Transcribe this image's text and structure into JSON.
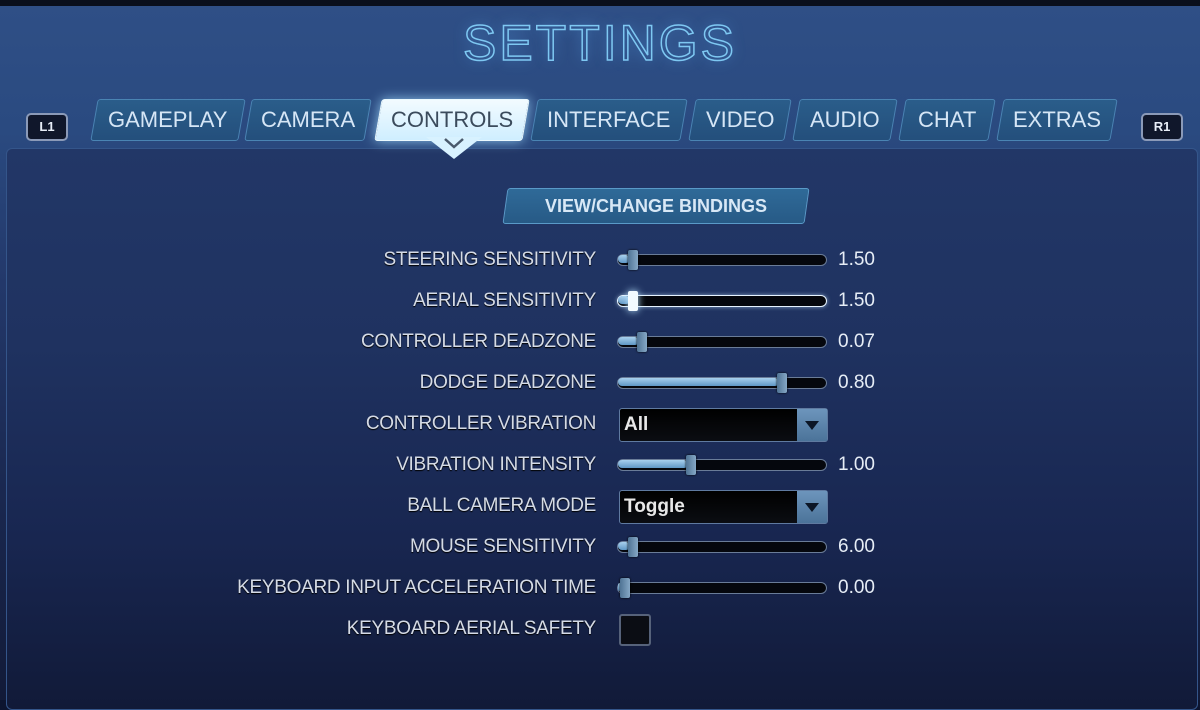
{
  "title": "SETTINGS",
  "shoulder_left": "L1",
  "shoulder_right": "R1",
  "tabs": [
    {
      "label": "GAMEPLAY",
      "active": false
    },
    {
      "label": "CAMERA",
      "active": false
    },
    {
      "label": "CONTROLS",
      "active": true
    },
    {
      "label": "INTERFACE",
      "active": false
    },
    {
      "label": "VIDEO",
      "active": false
    },
    {
      "label": "AUDIO",
      "active": false
    },
    {
      "label": "CHAT",
      "active": false
    },
    {
      "label": "EXTRAS",
      "active": false
    }
  ],
  "bindings_button": "VIEW/CHANGE BINDINGS",
  "settings": [
    {
      "label": "STEERING SENSITIVITY",
      "type": "slider",
      "value": "1.50",
      "fraction": 0.06
    },
    {
      "label": "AERIAL SENSITIVITY",
      "type": "slider",
      "value": "1.50",
      "fraction": 0.06,
      "highlighted": true
    },
    {
      "label": "CONTROLLER DEADZONE",
      "type": "slider",
      "value": "0.07",
      "fraction": 0.1
    },
    {
      "label": "DODGE DEADZONE",
      "type": "slider",
      "value": "0.80",
      "fraction": 0.78
    },
    {
      "label": "CONTROLLER VIBRATION",
      "type": "dropdown",
      "value": "All"
    },
    {
      "label": "VIBRATION INTENSITY",
      "type": "slider",
      "value": "1.00",
      "fraction": 0.34
    },
    {
      "label": "BALL CAMERA MODE",
      "type": "dropdown",
      "value": "Toggle"
    },
    {
      "label": "MOUSE SENSITIVITY",
      "type": "slider",
      "value": "6.00",
      "fraction": 0.06
    },
    {
      "label": "KEYBOARD INPUT ACCELERATION TIME",
      "type": "slider",
      "value": "0.00",
      "fraction": 0.02
    },
    {
      "label": "KEYBOARD AERIAL SAFETY",
      "type": "checkbox",
      "checked": false
    }
  ]
}
